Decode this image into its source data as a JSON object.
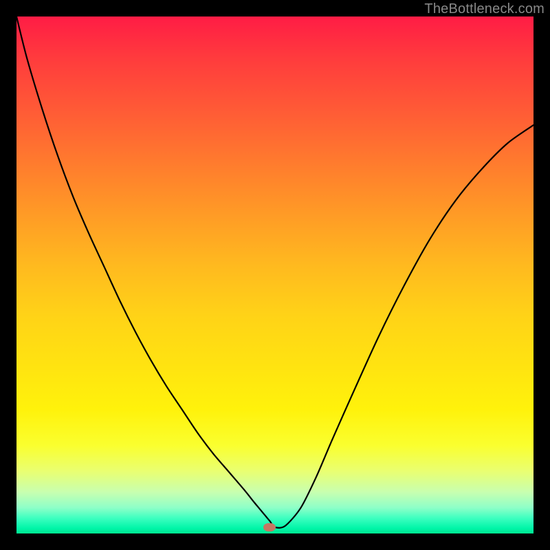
{
  "watermark": "TheBottleneck.com",
  "colors": {
    "frame_bg": "#000000",
    "curve": "#000000",
    "marker": "#c57763",
    "watermark": "#888888"
  },
  "chart_data": {
    "type": "line",
    "title": "",
    "xlabel": "",
    "ylabel": "",
    "xlim": [
      0,
      100
    ],
    "ylim": [
      0,
      100
    ],
    "grid": false,
    "x": [
      0,
      2,
      5,
      8,
      11,
      14,
      17,
      20,
      23,
      26,
      29,
      32,
      35,
      38,
      41,
      44,
      46,
      47,
      48,
      49,
      50,
      52,
      55,
      58,
      61,
      65,
      70,
      75,
      80,
      85,
      90,
      95,
      100
    ],
    "values": [
      100,
      92,
      82,
      73,
      65,
      58,
      51.5,
      45,
      39,
      33.5,
      28.5,
      24,
      19.5,
      15.5,
      12,
      8.5,
      6,
      4.8,
      3.6,
      2.4,
      1.2,
      1.5,
      5,
      11,
      18,
      27,
      38,
      48,
      57,
      64.5,
      70.5,
      75.5,
      79
    ],
    "marker": {
      "x": 49,
      "y": 1.2
    },
    "legend": false
  }
}
